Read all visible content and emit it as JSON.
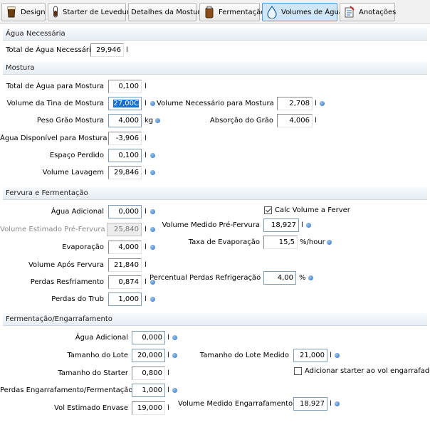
{
  "tabs": [
    {
      "label": "Design",
      "icon": "glass-icon"
    },
    {
      "label": "Starter de Levedura",
      "icon": "test-tube-icon"
    },
    {
      "label": "Detalhes da Mostura",
      "icon": ""
    },
    {
      "label": "Fermentação",
      "icon": "fermenter-icon"
    },
    {
      "label": "Volumes de Água",
      "icon": "water-drop-icon"
    },
    {
      "label": "Anotações",
      "icon": "notes-icon"
    }
  ],
  "agua": {
    "section": "Água Necessária",
    "total_label": "Total de Água Necessária",
    "total_value": "29,946",
    "total_unit": "l"
  },
  "mostura": {
    "section": "Mostura",
    "total_label": "Total de Água para Mostura",
    "total_value": "0,100",
    "total_unit": "l",
    "tina_label": "Volume da Tina de Mostura",
    "tina_value": "27,00C",
    "tina_unit": "l",
    "vol_nec_label": "Volume Necessário para Mostura",
    "vol_nec_value": "2,708",
    "vol_nec_unit": "l",
    "peso_label": "Peso Grão Mostura",
    "peso_value": "4,000",
    "peso_unit": "kg",
    "absorcao_label": "Absorção do Grão",
    "absorcao_value": "4,006",
    "absorcao_unit": "l",
    "disp_label": "Água Disponível para Mostura",
    "disp_value": "-3,906",
    "disp_unit": "l",
    "perdido_label": "Espaço Perdido",
    "perdido_value": "0,100",
    "perdido_unit": "l",
    "lavagem_label": "Volume Lavagem",
    "lavagem_value": "29,846",
    "lavagem_unit": "l"
  },
  "fervura": {
    "section": "Fervura e Fermentação",
    "adicional_label": "Água Adicional",
    "adicional_value": "0,000",
    "adicional_unit": "l",
    "calc_label": "Calc Volume a Ferver",
    "calc_checked": true,
    "estimado_label": "Volume Estimado Pré-Fervura",
    "estimado_value": "25,840",
    "estimado_unit": "l",
    "medido_label": "Volume Medido Pré-Fervura",
    "medido_value": "18,927",
    "medido_unit": "l",
    "evaporacao_label": "Evaporação",
    "evaporacao_value": "4,000",
    "evaporacao_unit": "l",
    "taxa_label": "Taxa de Evaporação",
    "taxa_value": "15,5",
    "taxa_unit": "%/hour",
    "apos_label": "Volume Após Fervura",
    "apos_value": "21,840",
    "apos_unit": "l",
    "resfr_label": "Perdas Resfriamento",
    "resfr_value": "0,874",
    "resfr_unit": "l",
    "perc_label": "Percentual Perdas Refrigeração",
    "perc_value": "4,00",
    "perc_unit": "%",
    "trub_label": "Perdas do Trub",
    "trub_value": "1,000",
    "trub_unit": "l"
  },
  "ferment": {
    "section": "Fermentação/Engarrafamento",
    "adicional_label": "Água Adicional",
    "adicional_value": "0,000",
    "adicional_unit": "l",
    "lote_label": "Tamanho do Lote",
    "lote_value": "20,000",
    "lote_unit": "l",
    "lote_med_label": "Tamanho do Lote Medido",
    "lote_med_value": "21,000",
    "lote_med_unit": "l",
    "starter_label": "Tamanho do Starter",
    "starter_value": "0,800",
    "starter_unit": "l",
    "add_starter_label": "Adicionar starter ao vol engarrafado",
    "add_starter_checked": false,
    "perdas_label": "Perdas Engarrafamento/Fermentação",
    "perdas_value": "1,000",
    "perdas_unit": "l",
    "envase_label": "Vol Estimado Envase",
    "envase_value": "19,000",
    "envase_unit": "l",
    "medido_label": "Volume Medido Engarrafamento",
    "medido_value": "18,927",
    "medido_unit": "l"
  },
  "colors": {
    "active_tab": "#cfe6f7",
    "info_dot": "#2f6fbd",
    "selection": "#1b6ccb"
  }
}
